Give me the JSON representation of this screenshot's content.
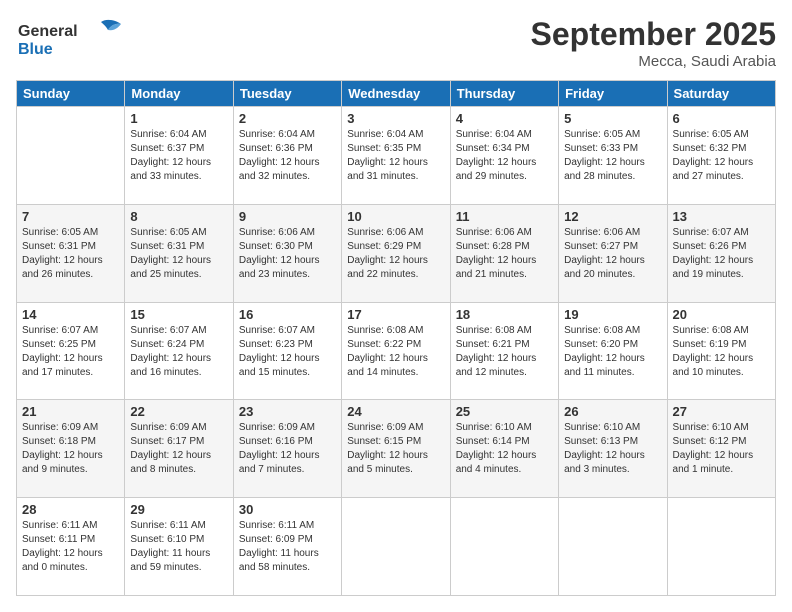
{
  "logo": {
    "line1": "General",
    "line2": "Blue"
  },
  "title": "September 2025",
  "subtitle": "Mecca, Saudi Arabia",
  "days_header": [
    "Sunday",
    "Monday",
    "Tuesday",
    "Wednesday",
    "Thursday",
    "Friday",
    "Saturday"
  ],
  "weeks": [
    [
      {
        "day": "",
        "info": ""
      },
      {
        "day": "1",
        "info": "Sunrise: 6:04 AM\nSunset: 6:37 PM\nDaylight: 12 hours\nand 33 minutes."
      },
      {
        "day": "2",
        "info": "Sunrise: 6:04 AM\nSunset: 6:36 PM\nDaylight: 12 hours\nand 32 minutes."
      },
      {
        "day": "3",
        "info": "Sunrise: 6:04 AM\nSunset: 6:35 PM\nDaylight: 12 hours\nand 31 minutes."
      },
      {
        "day": "4",
        "info": "Sunrise: 6:04 AM\nSunset: 6:34 PM\nDaylight: 12 hours\nand 29 minutes."
      },
      {
        "day": "5",
        "info": "Sunrise: 6:05 AM\nSunset: 6:33 PM\nDaylight: 12 hours\nand 28 minutes."
      },
      {
        "day": "6",
        "info": "Sunrise: 6:05 AM\nSunset: 6:32 PM\nDaylight: 12 hours\nand 27 minutes."
      }
    ],
    [
      {
        "day": "7",
        "info": "Sunrise: 6:05 AM\nSunset: 6:31 PM\nDaylight: 12 hours\nand 26 minutes."
      },
      {
        "day": "8",
        "info": "Sunrise: 6:05 AM\nSunset: 6:31 PM\nDaylight: 12 hours\nand 25 minutes."
      },
      {
        "day": "9",
        "info": "Sunrise: 6:06 AM\nSunset: 6:30 PM\nDaylight: 12 hours\nand 23 minutes."
      },
      {
        "day": "10",
        "info": "Sunrise: 6:06 AM\nSunset: 6:29 PM\nDaylight: 12 hours\nand 22 minutes."
      },
      {
        "day": "11",
        "info": "Sunrise: 6:06 AM\nSunset: 6:28 PM\nDaylight: 12 hours\nand 21 minutes."
      },
      {
        "day": "12",
        "info": "Sunrise: 6:06 AM\nSunset: 6:27 PM\nDaylight: 12 hours\nand 20 minutes."
      },
      {
        "day": "13",
        "info": "Sunrise: 6:07 AM\nSunset: 6:26 PM\nDaylight: 12 hours\nand 19 minutes."
      }
    ],
    [
      {
        "day": "14",
        "info": "Sunrise: 6:07 AM\nSunset: 6:25 PM\nDaylight: 12 hours\nand 17 minutes."
      },
      {
        "day": "15",
        "info": "Sunrise: 6:07 AM\nSunset: 6:24 PM\nDaylight: 12 hours\nand 16 minutes."
      },
      {
        "day": "16",
        "info": "Sunrise: 6:07 AM\nSunset: 6:23 PM\nDaylight: 12 hours\nand 15 minutes."
      },
      {
        "day": "17",
        "info": "Sunrise: 6:08 AM\nSunset: 6:22 PM\nDaylight: 12 hours\nand 14 minutes."
      },
      {
        "day": "18",
        "info": "Sunrise: 6:08 AM\nSunset: 6:21 PM\nDaylight: 12 hours\nand 12 minutes."
      },
      {
        "day": "19",
        "info": "Sunrise: 6:08 AM\nSunset: 6:20 PM\nDaylight: 12 hours\nand 11 minutes."
      },
      {
        "day": "20",
        "info": "Sunrise: 6:08 AM\nSunset: 6:19 PM\nDaylight: 12 hours\nand 10 minutes."
      }
    ],
    [
      {
        "day": "21",
        "info": "Sunrise: 6:09 AM\nSunset: 6:18 PM\nDaylight: 12 hours\nand 9 minutes."
      },
      {
        "day": "22",
        "info": "Sunrise: 6:09 AM\nSunset: 6:17 PM\nDaylight: 12 hours\nand 8 minutes."
      },
      {
        "day": "23",
        "info": "Sunrise: 6:09 AM\nSunset: 6:16 PM\nDaylight: 12 hours\nand 7 minutes."
      },
      {
        "day": "24",
        "info": "Sunrise: 6:09 AM\nSunset: 6:15 PM\nDaylight: 12 hours\nand 5 minutes."
      },
      {
        "day": "25",
        "info": "Sunrise: 6:10 AM\nSunset: 6:14 PM\nDaylight: 12 hours\nand 4 minutes."
      },
      {
        "day": "26",
        "info": "Sunrise: 6:10 AM\nSunset: 6:13 PM\nDaylight: 12 hours\nand 3 minutes."
      },
      {
        "day": "27",
        "info": "Sunrise: 6:10 AM\nSunset: 6:12 PM\nDaylight: 12 hours\nand 1 minute."
      }
    ],
    [
      {
        "day": "28",
        "info": "Sunrise: 6:11 AM\nSunset: 6:11 PM\nDaylight: 12 hours\nand 0 minutes."
      },
      {
        "day": "29",
        "info": "Sunrise: 6:11 AM\nSunset: 6:10 PM\nDaylight: 11 hours\nand 59 minutes."
      },
      {
        "day": "30",
        "info": "Sunrise: 6:11 AM\nSunset: 6:09 PM\nDaylight: 11 hours\nand 58 minutes."
      },
      {
        "day": "",
        "info": ""
      },
      {
        "day": "",
        "info": ""
      },
      {
        "day": "",
        "info": ""
      },
      {
        "day": "",
        "info": ""
      }
    ]
  ]
}
